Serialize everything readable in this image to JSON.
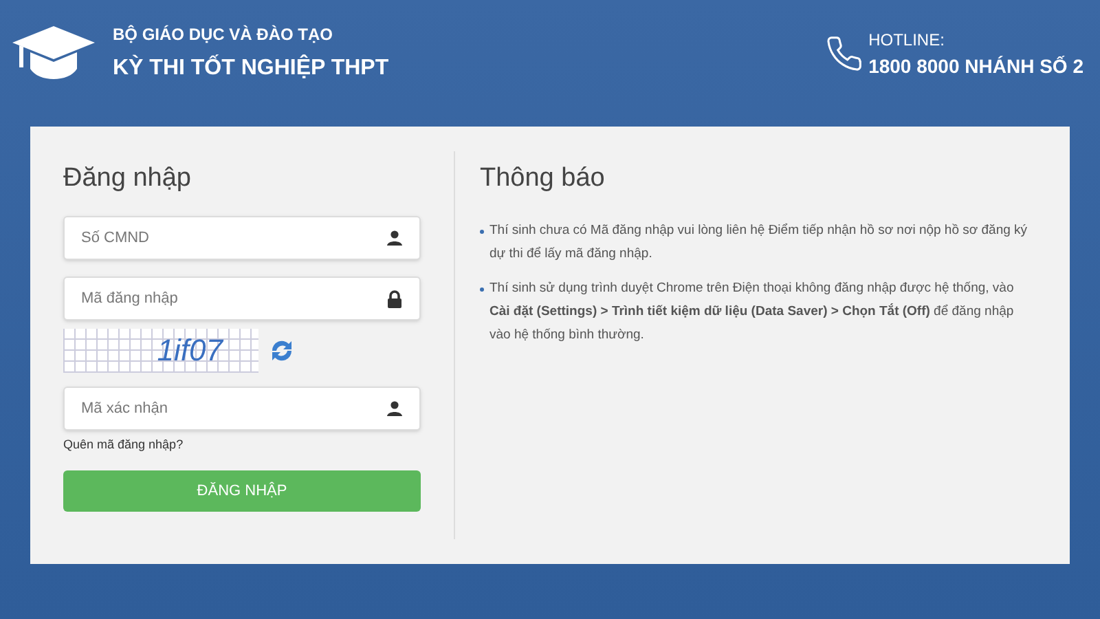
{
  "header": {
    "ministry": "BỘ GIÁO DỤC VÀ ĐÀO TẠO",
    "exam": "KỲ THI TỐT NGHIỆP THPT",
    "hotline_label": "HOTLINE:",
    "hotline_number": "1800 8000 NHÁNH SỐ 2"
  },
  "login": {
    "title": "Đăng nhập",
    "fields": [
      {
        "placeholder": "Số CMND",
        "kind": "user"
      },
      {
        "placeholder": "Mã đăng nhập",
        "kind": "lock"
      }
    ],
    "captcha_text": "1if07",
    "code_field": {
      "placeholder": "Mã xác nhận",
      "kind": "user"
    },
    "forgot_link": "Quên mã đăng nhập?",
    "submit": "ĐĂNG NHẬP"
  },
  "notice": {
    "title": "Thông báo",
    "items": [
      "Thí sinh chưa có Mã đăng nhập vui lòng liên hệ Điểm tiếp nhận hồ sơ nơi nộp hồ sơ đăng ký dự thi để lấy mã đăng nhập.",
      "Thí sinh sử dụng trình duyệt Chrome trên Điện thoại không đăng nhập được hệ thống, vào **Cài đặt (Settings) > Trình tiết kiệm dữ liệu (Data Saver) > Chọn Tắt (Off)** để đăng nhập vào hệ thống bình thường."
    ]
  }
}
